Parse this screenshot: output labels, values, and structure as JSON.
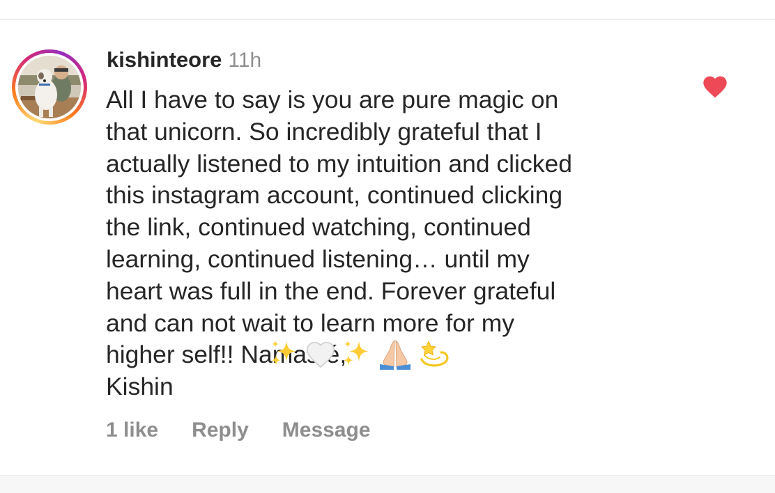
{
  "comment": {
    "username": "kishinteore",
    "timestamp": "11h",
    "text_lines": [
      "All I have to say is you are pure magic on",
      "that unicorn. So incredibly grateful that I",
      "actually listened to my intuition and clicked",
      "this instagram account, continued clicking",
      "the link, continued watching, continued",
      "learning, continued listening… until my",
      "heart was full in the end. Forever grateful",
      "and can not wait to learn more for my",
      "higher self!!                                         Namasté,",
      "Kishin"
    ],
    "emojis": [
      "sparkles-icon",
      "white-heart-icon",
      "sparkles-icon",
      "folded-hands-icon",
      "dizzy-icon"
    ],
    "liked": true,
    "like_color": "#ed4956"
  },
  "actions": {
    "likes": "1 like",
    "reply": "Reply",
    "message": "Message"
  },
  "colors": {
    "text": "#262626",
    "secondary": "#8e8e8e",
    "story_ring": [
      "#feda75",
      "#fa7e1e",
      "#d62976",
      "#962fbf"
    ]
  }
}
